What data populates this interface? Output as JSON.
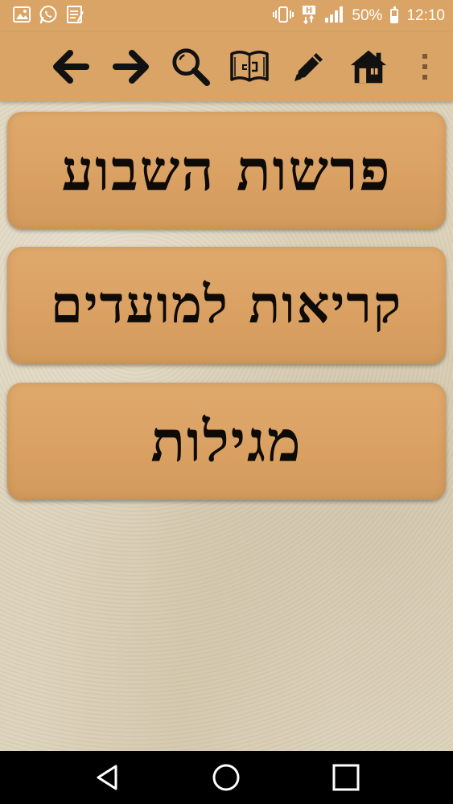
{
  "status_bar": {
    "battery_percent": "50%",
    "battery_level": 0.5,
    "time": "12:10",
    "network_badge": "H",
    "left_icons": [
      "gallery-notification-icon",
      "whatsapp-notification-icon",
      "notes-notification-icon"
    ],
    "right_icons": [
      "vibrate-icon",
      "mobile-data-icon",
      "signal-icon",
      "battery-icon"
    ]
  },
  "toolbar": {
    "buttons": [
      {
        "icon": "arrow-left-icon",
        "name": "back-button"
      },
      {
        "icon": "arrow-right-icon",
        "name": "forward-button"
      },
      {
        "icon": "search-icon",
        "name": "search-button"
      },
      {
        "icon": "book-icon",
        "name": "book-button"
      },
      {
        "icon": "pencil-icon",
        "name": "edit-button"
      },
      {
        "icon": "home-icon",
        "name": "home-button"
      },
      {
        "icon": "more-vert-icon",
        "name": "overflow-menu-button"
      }
    ]
  },
  "menu": {
    "items": [
      {
        "label": "פרשות השבוע"
      },
      {
        "label": "קריאות למועדים"
      },
      {
        "label": "מגילות"
      }
    ]
  },
  "nav_bar": {
    "buttons": [
      "back-nav-button",
      "home-nav-button",
      "recents-nav-button"
    ]
  },
  "colors": {
    "toolbar_bg": "#d9a466",
    "card_bg": "#d9a062",
    "text": "#0e0a06",
    "background": "#ddd3bb",
    "nav_bar_bg": "#000000"
  }
}
